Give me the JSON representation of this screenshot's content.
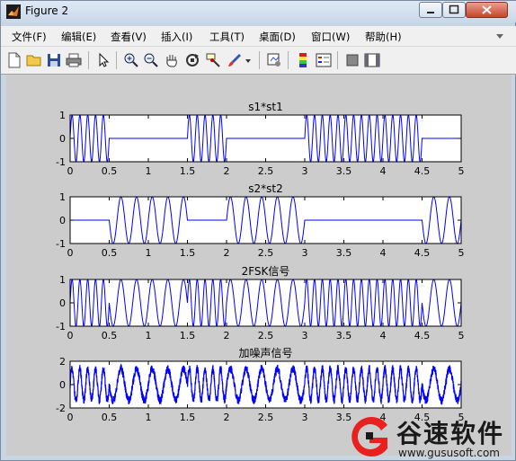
{
  "window": {
    "title": "Figure 2",
    "controls": [
      "minimize",
      "maximize",
      "close"
    ]
  },
  "menubar": {
    "items": [
      "文件(F)",
      "编辑(E)",
      "查看(V)",
      "插入(I)",
      "工具(T)",
      "桌面(D)",
      "窗口(W)",
      "帮助(H)"
    ]
  },
  "toolbar": {
    "buttons": [
      "new-figure",
      "open-file",
      "save-figure",
      "print-figure",
      "edit-plot",
      "zoom-in",
      "zoom-out",
      "pan",
      "rotate-3d",
      "data-cursor",
      "brush",
      "brush-menu",
      "link-plot",
      "insert-colorbar",
      "insert-legend",
      "hide-plot-tools",
      "show-plot-tools"
    ]
  },
  "chart_data": [
    {
      "type": "line",
      "title": "s1*st1",
      "xlim": [
        0,
        5
      ],
      "ylim": [
        -1,
        1
      ],
      "xticks": [
        "0",
        "0.5",
        "1",
        "1.5",
        "2",
        "2.5",
        "3",
        "3.5",
        "4",
        "4.5",
        "5"
      ],
      "yticks": [
        "-1",
        "0",
        "1"
      ],
      "bits": [
        1,
        0,
        0,
        1,
        0,
        0,
        1,
        1,
        1,
        0
      ],
      "carrier_cycles_per_unit": 10,
      "color": "#0000ff"
    },
    {
      "type": "line",
      "title": "s2*st2",
      "xlim": [
        0,
        5
      ],
      "ylim": [
        -1,
        1
      ],
      "xticks": [
        "0",
        "0.5",
        "1",
        "1.5",
        "2",
        "2.5",
        "3",
        "3.5",
        "4",
        "4.5",
        "5"
      ],
      "yticks": [
        "-1",
        "0",
        "1"
      ],
      "bits": [
        0,
        1,
        1,
        0,
        1,
        1,
        0,
        0,
        0,
        1
      ],
      "carrier_cycles_per_unit": 5,
      "color": "#0000ff"
    },
    {
      "type": "line",
      "title": "2FSK信号",
      "xlim": [
        0,
        5
      ],
      "ylim": [
        -1,
        1
      ],
      "xticks": [
        "0",
        "0.5",
        "1",
        "1.5",
        "2",
        "2.5",
        "3",
        "3.5",
        "4",
        "4.5",
        "5"
      ],
      "yticks": [
        "-1",
        "0",
        "1"
      ],
      "bits": [
        1,
        0,
        0,
        1,
        0,
        0,
        1,
        1,
        1,
        0
      ],
      "carrier_cycles_per_unit_bit1": 10,
      "carrier_cycles_per_unit_bit0": 5,
      "color": "#0000ff"
    },
    {
      "type": "line",
      "title": "加噪声信号",
      "xlim": [
        0,
        5
      ],
      "ylim": [
        -2,
        2
      ],
      "xticks": [
        "0",
        "0.5",
        "1",
        "1.5",
        "2",
        "2.5",
        "3",
        "3.5",
        "4",
        "4.5",
        "5"
      ],
      "yticks": [
        "-2",
        "0",
        "2"
      ],
      "bits": [
        1,
        0,
        0,
        1,
        0,
        0,
        1,
        1,
        1,
        0
      ],
      "noise_amplitude": 0.35,
      "color": "#0000ff"
    }
  ],
  "watermark": {
    "brand": "谷速软件",
    "url": "www.gususoft.com"
  }
}
